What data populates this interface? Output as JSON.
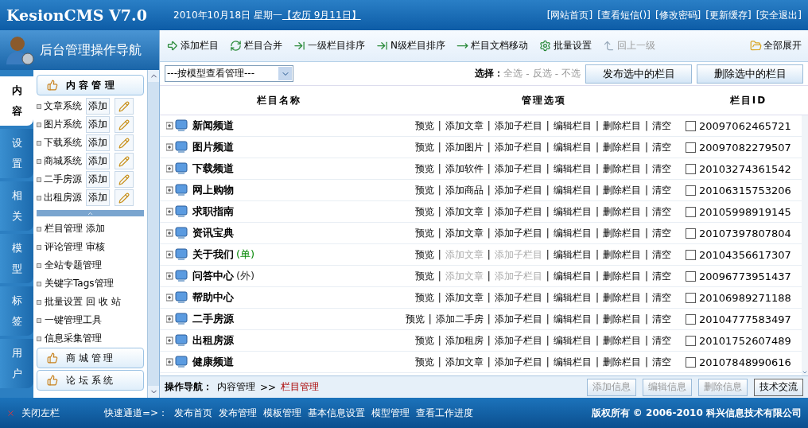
{
  "header": {
    "logo": "KesionCMS V7.0",
    "date": "2010年10月18日 星期一",
    "lunar": "【农历 9月11日】",
    "links": [
      "[网站首页]",
      "[查看短信()]",
      "[修改密码]",
      "[更新缓存]",
      "[安全退出]"
    ]
  },
  "sidebar": {
    "title": "后台管理操作导航",
    "tabs": [
      {
        "label": "内容",
        "selected": true
      },
      {
        "label": "设置",
        "selected": false
      },
      {
        "label": "相关",
        "selected": false
      },
      {
        "label": "模型",
        "selected": false
      },
      {
        "label": "标签",
        "selected": false
      },
      {
        "label": "用户",
        "selected": false
      }
    ],
    "groups": [
      {
        "label": "内 容 管 理",
        "expanded": true,
        "modules": [
          {
            "label": "文章系统",
            "add": "添加"
          },
          {
            "label": "图片系统",
            "add": "添加"
          },
          {
            "label": "下载系统",
            "add": "添加"
          },
          {
            "label": "商城系统",
            "add": "添加"
          },
          {
            "label": "二手房源",
            "add": "添加"
          },
          {
            "label": "出租房源",
            "add": "添加"
          }
        ],
        "links": [
          [
            "栏目管理",
            "添加"
          ],
          [
            "评论管理",
            "审核"
          ],
          [
            "全站专题管理"
          ],
          [
            "关键字Tags管理"
          ],
          [
            "批量设置",
            "回 收 站"
          ],
          [
            "一键管理工具"
          ],
          [
            "信息采集管理"
          ]
        ]
      },
      {
        "label": "商 城 管 理",
        "expanded": false
      },
      {
        "label": "论 坛 系 统",
        "expanded": false
      }
    ]
  },
  "toolbar": [
    {
      "label": "添加栏目",
      "disabled": false
    },
    {
      "label": "栏目合并",
      "disabled": false
    },
    {
      "label": "一级栏目排序",
      "disabled": false
    },
    {
      "label": "N级栏目排序",
      "disabled": false
    },
    {
      "label": "栏目文档移动",
      "disabled": false
    },
    {
      "label": "批量设置",
      "disabled": false
    },
    {
      "label": "回上一级",
      "disabled": true
    }
  ],
  "expand_all": "全部展开",
  "filter": {
    "value": "---按模型查看管理---",
    "select_label": "选择：",
    "select_links": [
      "全选",
      "反选",
      "不选"
    ],
    "select_separator": "-",
    "buttons": [
      "发布选中的栏目",
      "删除选中的栏目"
    ]
  },
  "table": {
    "columns": [
      "栏目名称",
      "管理选项",
      "栏目ID"
    ],
    "action_separator": "|",
    "rows": [
      {
        "name": "新闻频道",
        "actions": [
          {
            "label": "预览",
            "disabled": false
          },
          {
            "label": "添加文章",
            "disabled": false
          },
          {
            "label": "添加子栏目",
            "disabled": false
          },
          {
            "label": "编辑栏目",
            "disabled": false
          },
          {
            "label": "删除栏目",
            "disabled": false
          },
          {
            "label": "清空",
            "disabled": false
          }
        ],
        "id": "20097062465721",
        "checked": false
      },
      {
        "name": "图片频道",
        "actions": [
          {
            "label": "预览",
            "disabled": false
          },
          {
            "label": "添加图片",
            "disabled": false
          },
          {
            "label": "添加子栏目",
            "disabled": false
          },
          {
            "label": "编辑栏目",
            "disabled": false
          },
          {
            "label": "删除栏目",
            "disabled": false
          },
          {
            "label": "清空",
            "disabled": false
          }
        ],
        "id": "20097082279507",
        "checked": false
      },
      {
        "name": "下载频道",
        "actions": [
          {
            "label": "预览",
            "disabled": false
          },
          {
            "label": "添加软件",
            "disabled": false
          },
          {
            "label": "添加子栏目",
            "disabled": false
          },
          {
            "label": "编辑栏目",
            "disabled": false
          },
          {
            "label": "删除栏目",
            "disabled": false
          },
          {
            "label": "清空",
            "disabled": false
          }
        ],
        "id": "20103274361542",
        "checked": false
      },
      {
        "name": "网上购物",
        "actions": [
          {
            "label": "预览",
            "disabled": false
          },
          {
            "label": "添加商品",
            "disabled": false
          },
          {
            "label": "添加子栏目",
            "disabled": false
          },
          {
            "label": "编辑栏目",
            "disabled": false
          },
          {
            "label": "删除栏目",
            "disabled": false
          },
          {
            "label": "清空",
            "disabled": false
          }
        ],
        "id": "20106315753206",
        "checked": false
      },
      {
        "name": "求职指南",
        "actions": [
          {
            "label": "预览",
            "disabled": false
          },
          {
            "label": "添加文章",
            "disabled": false
          },
          {
            "label": "添加子栏目",
            "disabled": false
          },
          {
            "label": "编辑栏目",
            "disabled": false
          },
          {
            "label": "删除栏目",
            "disabled": false
          },
          {
            "label": "清空",
            "disabled": false
          }
        ],
        "id": "20105998919145",
        "checked": false
      },
      {
        "name": "资讯宝典",
        "actions": [
          {
            "label": "预览",
            "disabled": false
          },
          {
            "label": "添加文章",
            "disabled": false
          },
          {
            "label": "添加子栏目",
            "disabled": false
          },
          {
            "label": "编辑栏目",
            "disabled": false
          },
          {
            "label": "删除栏目",
            "disabled": false
          },
          {
            "label": "清空",
            "disabled": false
          }
        ],
        "id": "20107397807804",
        "checked": false
      },
      {
        "name": "关于我们",
        "tag": {
          "text": "(单)",
          "kind": "single"
        },
        "actions": [
          {
            "label": "预览",
            "disabled": false
          },
          {
            "label": "添加文章",
            "disabled": true
          },
          {
            "label": "添加子栏目",
            "disabled": true
          },
          {
            "label": "编辑栏目",
            "disabled": false
          },
          {
            "label": "删除栏目",
            "disabled": false
          },
          {
            "label": "清空",
            "disabled": false
          }
        ],
        "id": "20104356617307",
        "checked": false
      },
      {
        "name": "问答中心",
        "tag": {
          "text": "(外)",
          "kind": "external"
        },
        "actions": [
          {
            "label": "预览",
            "disabled": false
          },
          {
            "label": "添加文章",
            "disabled": true
          },
          {
            "label": "添加子栏目",
            "disabled": true
          },
          {
            "label": "编辑栏目",
            "disabled": false
          },
          {
            "label": "删除栏目",
            "disabled": false
          },
          {
            "label": "清空",
            "disabled": false
          }
        ],
        "id": "20096773951437",
        "checked": false
      },
      {
        "name": "帮助中心",
        "actions": [
          {
            "label": "预览",
            "disabled": false
          },
          {
            "label": "添加文章",
            "disabled": false
          },
          {
            "label": "添加子栏目",
            "disabled": false
          },
          {
            "label": "编辑栏目",
            "disabled": false
          },
          {
            "label": "删除栏目",
            "disabled": false
          },
          {
            "label": "清空",
            "disabled": false
          }
        ],
        "id": "20106989271188",
        "checked": false
      },
      {
        "name": "二手房源",
        "actions": [
          {
            "label": "预览",
            "disabled": false
          },
          {
            "label": "添加二手房",
            "disabled": false
          },
          {
            "label": "添加子栏目",
            "disabled": false
          },
          {
            "label": "编辑栏目",
            "disabled": false
          },
          {
            "label": "删除栏目",
            "disabled": false
          },
          {
            "label": "清空",
            "disabled": false
          }
        ],
        "id": "20104777583497",
        "checked": false
      },
      {
        "name": "出租房源",
        "actions": [
          {
            "label": "预览",
            "disabled": false
          },
          {
            "label": "添加租房",
            "disabled": false
          },
          {
            "label": "添加子栏目",
            "disabled": false
          },
          {
            "label": "编辑栏目",
            "disabled": false
          },
          {
            "label": "删除栏目",
            "disabled": false
          },
          {
            "label": "清空",
            "disabled": false
          }
        ],
        "id": "20101752607489",
        "checked": false
      },
      {
        "name": "健康频道",
        "actions": [
          {
            "label": "预览",
            "disabled": false
          },
          {
            "label": "添加文章",
            "disabled": false
          },
          {
            "label": "添加子栏目",
            "disabled": false
          },
          {
            "label": "编辑栏目",
            "disabled": false
          },
          {
            "label": "删除栏目",
            "disabled": false
          },
          {
            "label": "清空",
            "disabled": false
          }
        ],
        "id": "20107848990616",
        "checked": false
      }
    ]
  },
  "breadcrumb": {
    "label": "操作导航：",
    "path": "内容管理",
    "separator": ">>",
    "current": "栏目管理"
  },
  "footer_buttons": [
    {
      "label": "添加信息",
      "disabled": true
    },
    {
      "label": "编辑信息",
      "disabled": true
    },
    {
      "label": "删除信息",
      "disabled": true
    },
    {
      "label": "技术交流",
      "disabled": false
    }
  ],
  "status_bar": {
    "close": "关闭左栏",
    "quick_label": "快速通道=>：",
    "quick_links": [
      "发布首页",
      "发布管理",
      "模板管理",
      "基本信息设置",
      "模型管理",
      "查看工作进度"
    ],
    "copyright": "版权所有 © 2006-2010 科兴信息技术有限公司"
  }
}
